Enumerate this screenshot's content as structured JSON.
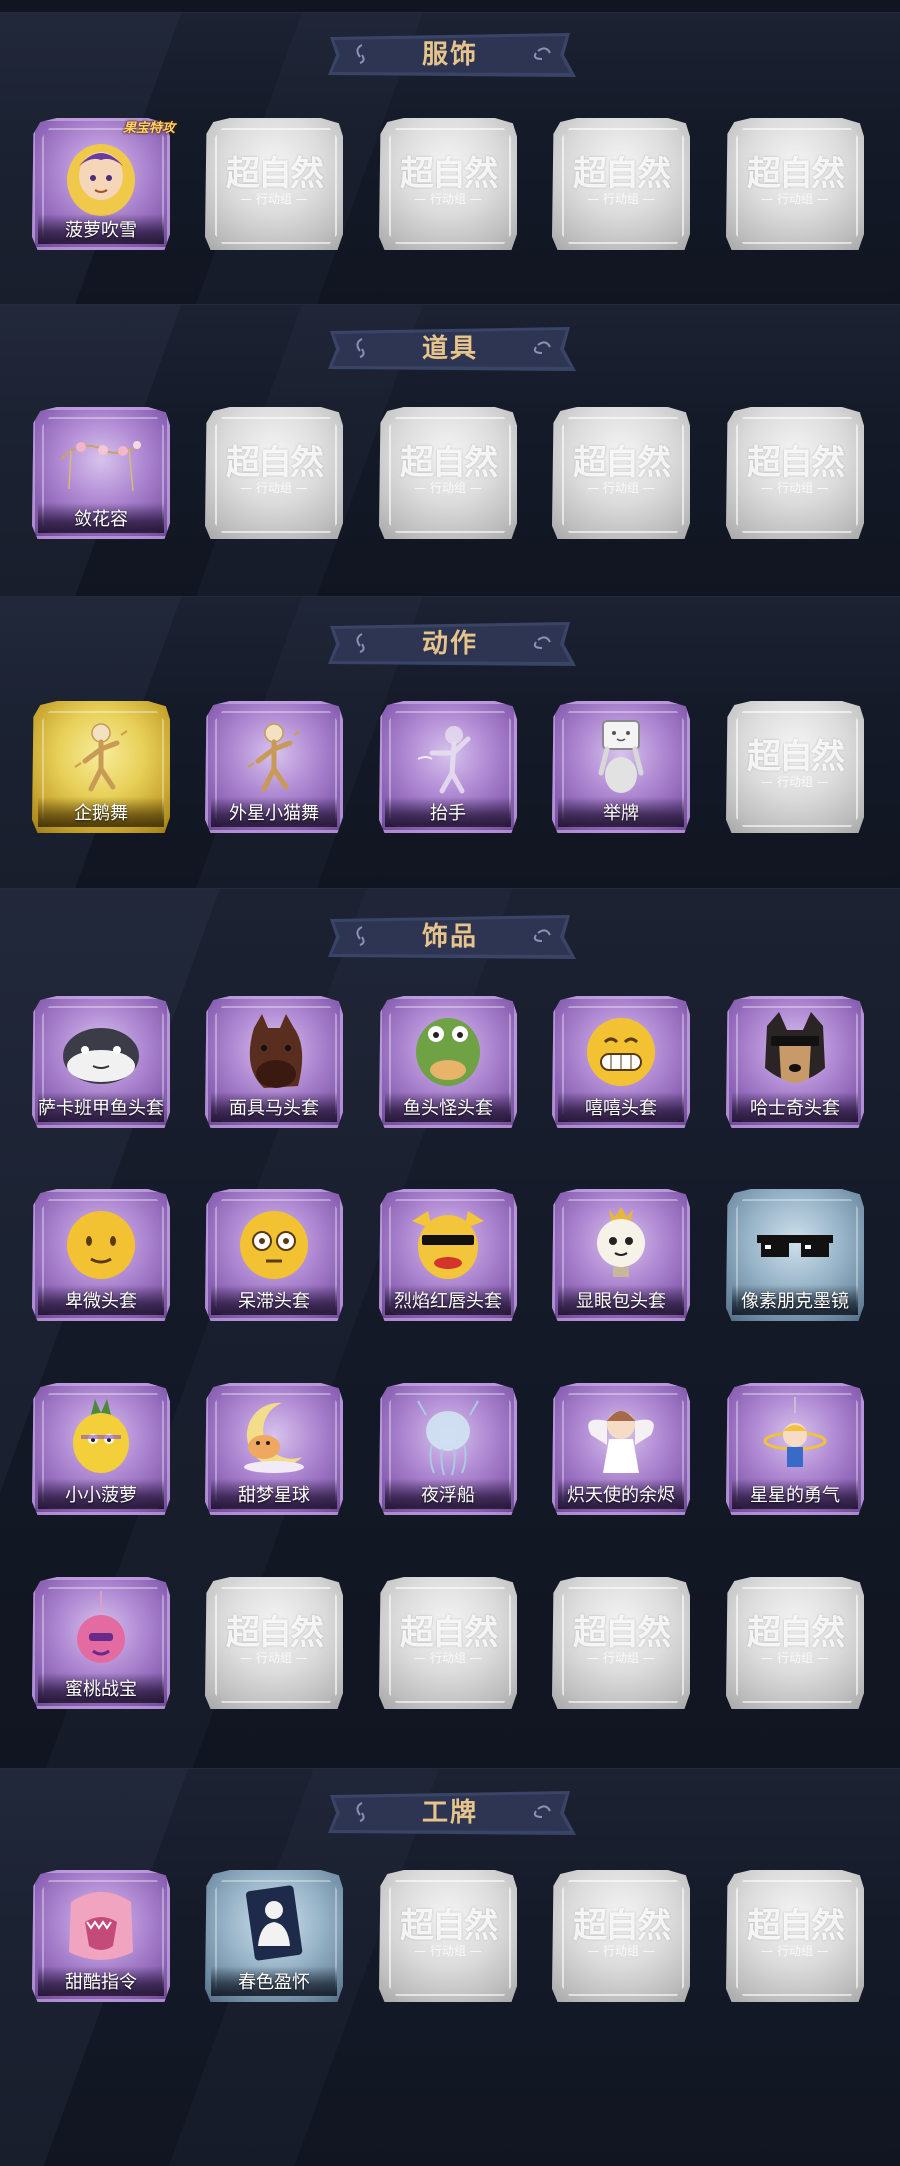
{
  "sections": [
    {
      "title": "服饰",
      "items": [
        {
          "label": "菠萝吹雪",
          "rarity": "purple",
          "art": "character-portrait-icon",
          "badge": "果宝特攻"
        },
        {
          "label": "",
          "rarity": "empty"
        },
        {
          "label": "",
          "rarity": "empty"
        },
        {
          "label": "",
          "rarity": "empty"
        },
        {
          "label": "",
          "rarity": "empty"
        }
      ]
    },
    {
      "title": "道具",
      "items": [
        {
          "label": "敛花容",
          "rarity": "purple",
          "art": "flower-hairpin-icon"
        },
        {
          "label": "",
          "rarity": "empty"
        },
        {
          "label": "",
          "rarity": "empty"
        },
        {
          "label": "",
          "rarity": "empty"
        },
        {
          "label": "",
          "rarity": "empty"
        }
      ]
    },
    {
      "title": "动作",
      "items": [
        {
          "label": "企鹅舞",
          "rarity": "gold",
          "art": "dance-figure-icon"
        },
        {
          "label": "外星小猫舞",
          "rarity": "purple",
          "art": "dance-figure-icon"
        },
        {
          "label": "抬手",
          "rarity": "purple",
          "art": "raise-hand-figure-icon"
        },
        {
          "label": "举牌",
          "rarity": "purple",
          "art": "hold-sign-figure-icon"
        },
        {
          "label": "",
          "rarity": "empty"
        }
      ]
    },
    {
      "title": "饰品",
      "items": [
        {
          "label": "萨卡班甲鱼头套",
          "rarity": "purple",
          "art": "fish-head-icon"
        },
        {
          "label": "面具马头套",
          "rarity": "purple",
          "art": "horse-head-icon"
        },
        {
          "label": "鱼头怪头套",
          "rarity": "purple",
          "art": "frog-head-icon"
        },
        {
          "label": "嘻嘻头套",
          "rarity": "purple",
          "art": "grin-emoji-icon"
        },
        {
          "label": "哈士奇头套",
          "rarity": "purple",
          "art": "husky-head-icon"
        },
        {
          "label": "卑微头套",
          "rarity": "purple",
          "art": "shy-emoji-icon"
        },
        {
          "label": "呆滞头套",
          "rarity": "purple",
          "art": "stare-emoji-icon"
        },
        {
          "label": "烈焰红唇头套",
          "rarity": "purple",
          "art": "pikachu-head-icon"
        },
        {
          "label": "显眼包头套",
          "rarity": "purple",
          "art": "bulb-head-icon"
        },
        {
          "label": "像素朋克墨镜",
          "rarity": "blue",
          "art": "pixel-sunglasses-icon"
        },
        {
          "label": "小小菠萝",
          "rarity": "purple",
          "art": "pineapple-mascot-icon"
        },
        {
          "label": "甜梦星球",
          "rarity": "purple",
          "art": "moon-fox-icon"
        },
        {
          "label": "夜浮船",
          "rarity": "purple",
          "art": "jellyfish-icon"
        },
        {
          "label": "炽天使的余烬",
          "rarity": "purple",
          "art": "angel-doll-icon"
        },
        {
          "label": "星星的勇气",
          "rarity": "purple",
          "art": "star-charm-icon"
        },
        {
          "label": "蜜桃战宝",
          "rarity": "purple",
          "art": "peach-charm-icon"
        },
        {
          "label": "",
          "rarity": "empty"
        },
        {
          "label": "",
          "rarity": "empty"
        },
        {
          "label": "",
          "rarity": "empty"
        },
        {
          "label": "",
          "rarity": "empty"
        }
      ]
    },
    {
      "title": "工牌",
      "items": [
        {
          "label": "甜酷指令",
          "rarity": "purple",
          "art": "monster-badge-icon"
        },
        {
          "label": "春色盈怀",
          "rarity": "blue",
          "art": "silhouette-card-icon"
        },
        {
          "label": "",
          "rarity": "empty"
        },
        {
          "label": "",
          "rarity": "empty"
        },
        {
          "label": "",
          "rarity": "empty"
        }
      ]
    }
  ],
  "placeholder": {
    "logo": "超自然",
    "sub": "— 行动组 —"
  },
  "colors": {
    "background": "#111521",
    "banner_fill": "#3a4466",
    "banner_text": "#e6c48b",
    "rarity_purple": "#b48fd6",
    "rarity_gold": "#e8d15a",
    "rarity_blue": "#98b4c8",
    "empty": "#dcdcdc"
  }
}
